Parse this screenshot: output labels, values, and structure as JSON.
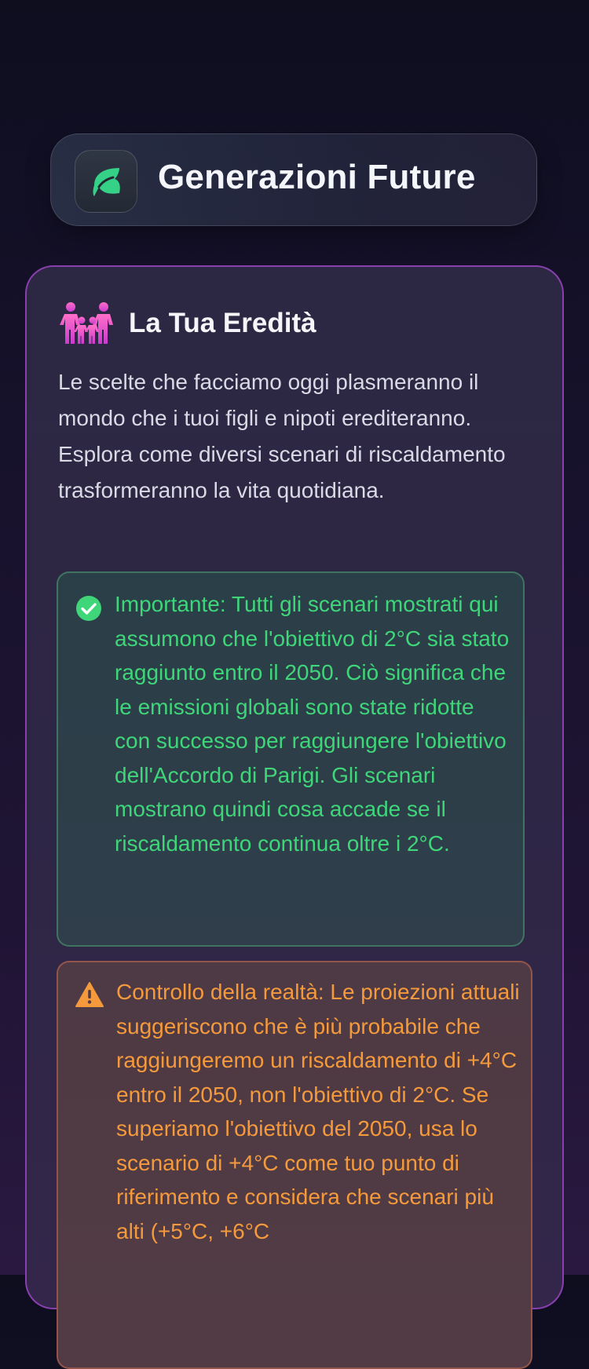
{
  "header": {
    "title": "Generazioni Future",
    "logo_icon": "leaf-icon",
    "accent": "#34d187"
  },
  "legacy_card": {
    "icon": "family-icon",
    "title": "La Tua Eredità",
    "description": "Le scelte che facciamo oggi plasmeranno il mondo che i tuoi figli e nipoti erediteranno. Esplora come diversi scenari di riscaldamento trasformeranno la vita quotidiana.",
    "border_color": "#a848d2"
  },
  "info_notice": {
    "icon": "check-circle-icon",
    "text": "Importante: Tutti gli scenari mostrati qui assumono che l'obiettivo di 2°C sia stato raggiunto entro il 2050. Ciò significa che le emissioni globali sono state ridotte con successo per raggiungere l'obiettivo dell'Accordo di Parigi. Gli scenari mostrano quindi cosa accade se il riscaldamento continua oltre i 2°C.",
    "color": "#3fd67a"
  },
  "warning_notice": {
    "icon": "warning-triangle-icon",
    "text": "Controllo della realtà: Le proiezioni attuali suggeriscono che è più probabile che raggiungeremo un riscaldamento di +4°C entro il 2050, non l'obiettivo di 2°C. Se superiamo l'obiettivo del 2050, usa lo scenario di +4°C come tuo punto di riferimento e considera che scenari più alti (+5°C, +6°C",
    "color": "#f59a3c"
  }
}
